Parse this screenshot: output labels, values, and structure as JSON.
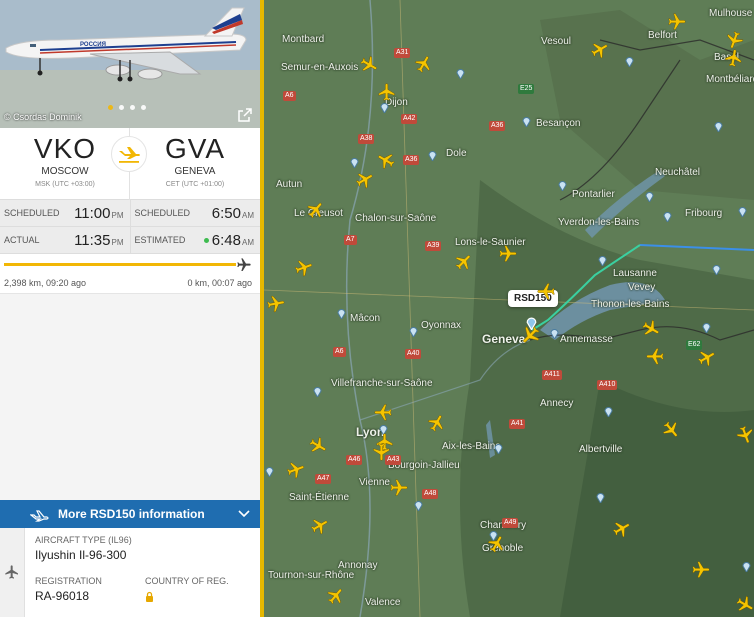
{
  "photo": {
    "credit": "© Csordas Dominik",
    "dots": 4,
    "active_dot": 1,
    "expand_icon": "external-link-icon"
  },
  "route": {
    "origin": {
      "code": "VKO",
      "city": "MOSCOW",
      "tz": "MSK (UTC +03:00)"
    },
    "destination": {
      "code": "GVA",
      "city": "GENEVA",
      "tz": "CET (UTC +01:00)"
    },
    "mid_icon": "plane-landing-icon"
  },
  "times": {
    "scheduled_label": "SCHEDULED",
    "actual_label": "ACTUAL",
    "estimated_label": "ESTIMATED",
    "dep_scheduled": "11:00",
    "dep_scheduled_ampm": "PM",
    "arr_scheduled": "6:50",
    "arr_scheduled_ampm": "AM",
    "dep_actual": "11:35",
    "dep_actual_ampm": "PM",
    "arr_estimated": "6:48",
    "arr_estimated_ampm": "AM"
  },
  "progress": {
    "fraction": 1.0,
    "flown": "2,398 km, 09:20 ago",
    "remaining": "0 km, 00:07 ago"
  },
  "more": {
    "label": "More RSD150 information"
  },
  "details": {
    "aircraft_type_label": "AIRCRAFT TYPE (IL96)",
    "aircraft_type": "Ilyushin Il-96-300",
    "registration_label": "REGISTRATION",
    "registration": "RA-96018",
    "country_label": "COUNTRY OF REG."
  },
  "map": {
    "flight_label": "RSD150",
    "cities": [
      "Montbard",
      "Vesoul",
      "Belfort",
      "Mulhouse",
      "Basel",
      "Semur-en-Auxois",
      "Dijon",
      "Besançon",
      "Dole",
      "Autun",
      "Neuchâtel",
      "Le Creusot",
      "Chalon-sur-Saône",
      "Yverdon-les-Bains",
      "Fribourg",
      "Lons-le-Saunier",
      "Lausanne",
      "Mâcon",
      "Oyonnax",
      "Geneva",
      "Annemasse",
      "Thonon-les-Bains",
      "Villefranche-sur-Saône",
      "Annecy",
      "Lyon",
      "Aix-les-Bains",
      "Bourgoin-Jallieu",
      "Vienne",
      "Saint-Étienne",
      "Chambéry",
      "Grenoble",
      "Annonay",
      "Tournon-sur-Rhône",
      "Valence",
      "Vevey",
      "Albertville",
      "Montbéliard",
      "Pontarlier"
    ],
    "roads": [
      "A31",
      "A36",
      "A6",
      "A39",
      "A40",
      "A41",
      "A43",
      "A46",
      "A47",
      "A48",
      "A49",
      "A7",
      "A42",
      "A38",
      "A5",
      "A411",
      "A410",
      "E25",
      "E62"
    ],
    "colors": {
      "track_green": "#3ad0a0",
      "track_blue": "#3b8fe8",
      "accent": "#f2b705",
      "brand_blue": "#1f6db0"
    }
  }
}
